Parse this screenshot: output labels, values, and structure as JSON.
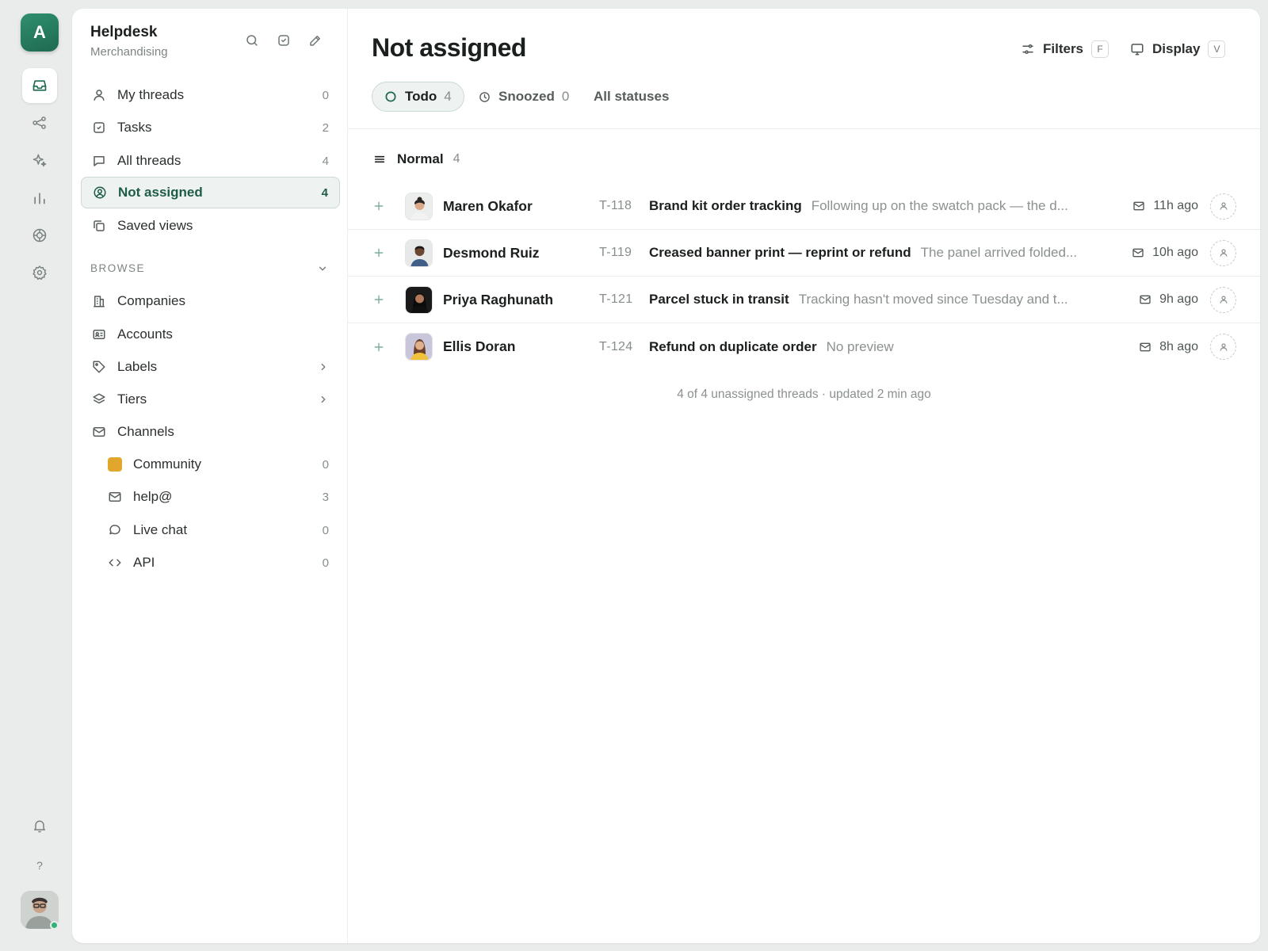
{
  "app": {
    "logo_letter": "A",
    "accent_color": "#1e6a51"
  },
  "rail": {
    "items": [
      {
        "name": "inbox-icon",
        "active": true
      },
      {
        "name": "share-nodes-icon",
        "active": false
      },
      {
        "name": "sparkles-icon",
        "active": false
      },
      {
        "name": "bar-chart-icon",
        "active": false
      },
      {
        "name": "target-icon",
        "active": false
      },
      {
        "name": "gear-icon",
        "active": false
      }
    ],
    "bottom": [
      {
        "name": "bell-icon"
      },
      {
        "name": "help-icon",
        "glyph": "?"
      }
    ]
  },
  "sidebar": {
    "workspace_name": "Helpdesk",
    "workspace_sub": "Merchandising",
    "tools": [
      "search-icon",
      "check-square-icon",
      "pencil-icon"
    ],
    "nav": [
      {
        "label": "My threads",
        "count": "0",
        "icon": "user-icon"
      },
      {
        "label": "Tasks",
        "count": "2",
        "icon": "check-square-icon"
      },
      {
        "label": "All threads",
        "count": "4",
        "icon": "chat-bubble-icon"
      },
      {
        "label": "Not assigned",
        "count": "4",
        "icon": "user-circle-icon",
        "active": true
      },
      {
        "label": "Saved views",
        "count": "",
        "icon": "copy-icon"
      }
    ],
    "browse_label": "BROWSE",
    "browse": [
      {
        "label": "Companies",
        "icon": "building-icon"
      },
      {
        "label": "Accounts",
        "icon": "id-card-icon"
      },
      {
        "label": "Labels",
        "icon": "tag-icon",
        "chevron": true
      },
      {
        "label": "Tiers",
        "icon": "layers-icon",
        "chevron": true
      },
      {
        "label": "Channels",
        "icon": "mail-icon"
      }
    ],
    "channels": [
      {
        "label": "Community",
        "count": "0",
        "icon": "community-swatch",
        "color": "#e0a72c"
      },
      {
        "label": "help@",
        "count": "3",
        "icon": "mail-icon"
      },
      {
        "label": "Live chat",
        "count": "0",
        "icon": "chat-bubble-icon"
      },
      {
        "label": "API",
        "count": "0",
        "icon": "code-icon"
      }
    ]
  },
  "main": {
    "title": "Not assigned",
    "filters_label": "Filters",
    "filters_key": "F",
    "display_label": "Display",
    "display_key": "V",
    "tabs": [
      {
        "label": "Todo",
        "count": "4",
        "icon": "circle-icon",
        "active": true
      },
      {
        "label": "Snoozed",
        "count": "0",
        "icon": "clock-icon"
      },
      {
        "label": "All statuses",
        "count": ""
      }
    ],
    "group": {
      "label": "Normal",
      "count": "4",
      "icon": "priority-lines-icon"
    },
    "threads": [
      {
        "name": "Maren Okafor",
        "id": "T-118",
        "subject": "Brand kit order tracking",
        "preview": "Following up on the swatch pack — the d...",
        "time": "11h ago"
      },
      {
        "name": "Desmond Ruiz",
        "id": "T-119",
        "subject": "Creased banner print — reprint or refund",
        "preview": "The panel arrived folded...",
        "time": "10h ago"
      },
      {
        "name": "Priya Raghunath",
        "id": "T-121",
        "subject": "Parcel stuck in transit",
        "preview": "Tracking hasn't moved since Tuesday and t...",
        "time": "9h ago"
      },
      {
        "name": "Ellis Doran",
        "id": "T-124",
        "subject": "Refund on duplicate order",
        "preview": "No preview",
        "time": "8h ago"
      }
    ],
    "footer": "4 of 4 unassigned threads · updated 2 min ago"
  }
}
